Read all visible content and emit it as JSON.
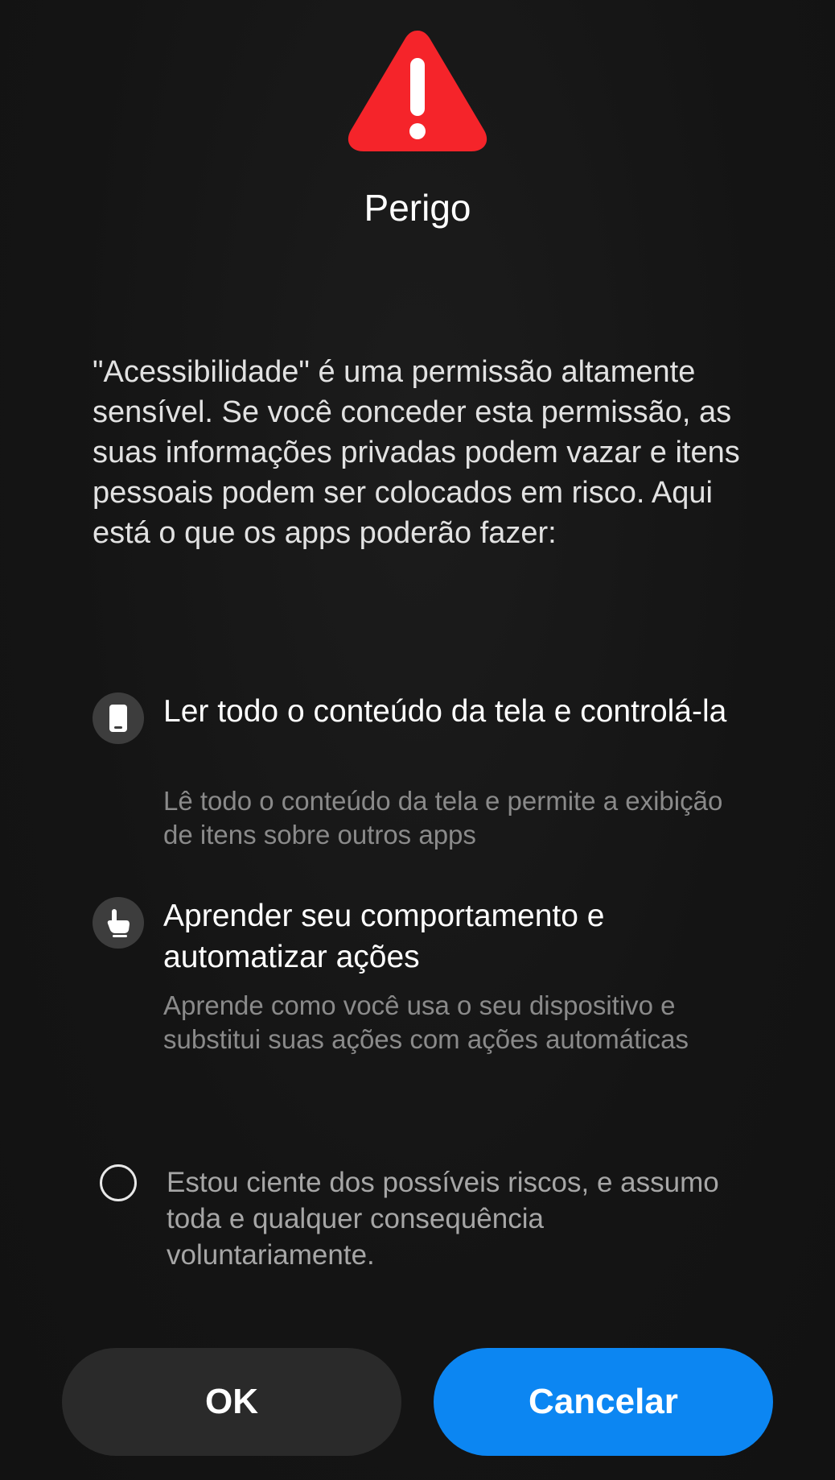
{
  "dialog": {
    "title": "Perigo",
    "description": "\"Acessibilidade\" é uma permissão altamente sensível. Se você conceder esta permissão, as suas informações privadas podem vazar e itens pessoais podem ser colocados em risco. Aqui está o que os apps poderão fazer:",
    "warning_icon": "warning-triangle-icon",
    "warning_color": "#f5242a"
  },
  "permissions": [
    {
      "icon": "phone-screen-icon",
      "title": "Ler todo o conteúdo da tela e controlá-la",
      "description": "Lê todo o conteúdo da tela e permite a exibição de itens sobre outros apps"
    },
    {
      "icon": "hand-pointer-icon",
      "title": "Aprender seu comportamento e automatizar ações",
      "description": "Aprende como você usa o seu dispositivo e substitui suas ações com ações automáticas"
    }
  ],
  "consent": {
    "label": "Estou ciente dos possíveis riscos, e assumo toda e qualquer consequência voluntariamente.",
    "checked": false
  },
  "buttons": {
    "ok_label": "OK",
    "cancel_label": "Cancelar",
    "cancel_color": "#0c86f2"
  }
}
